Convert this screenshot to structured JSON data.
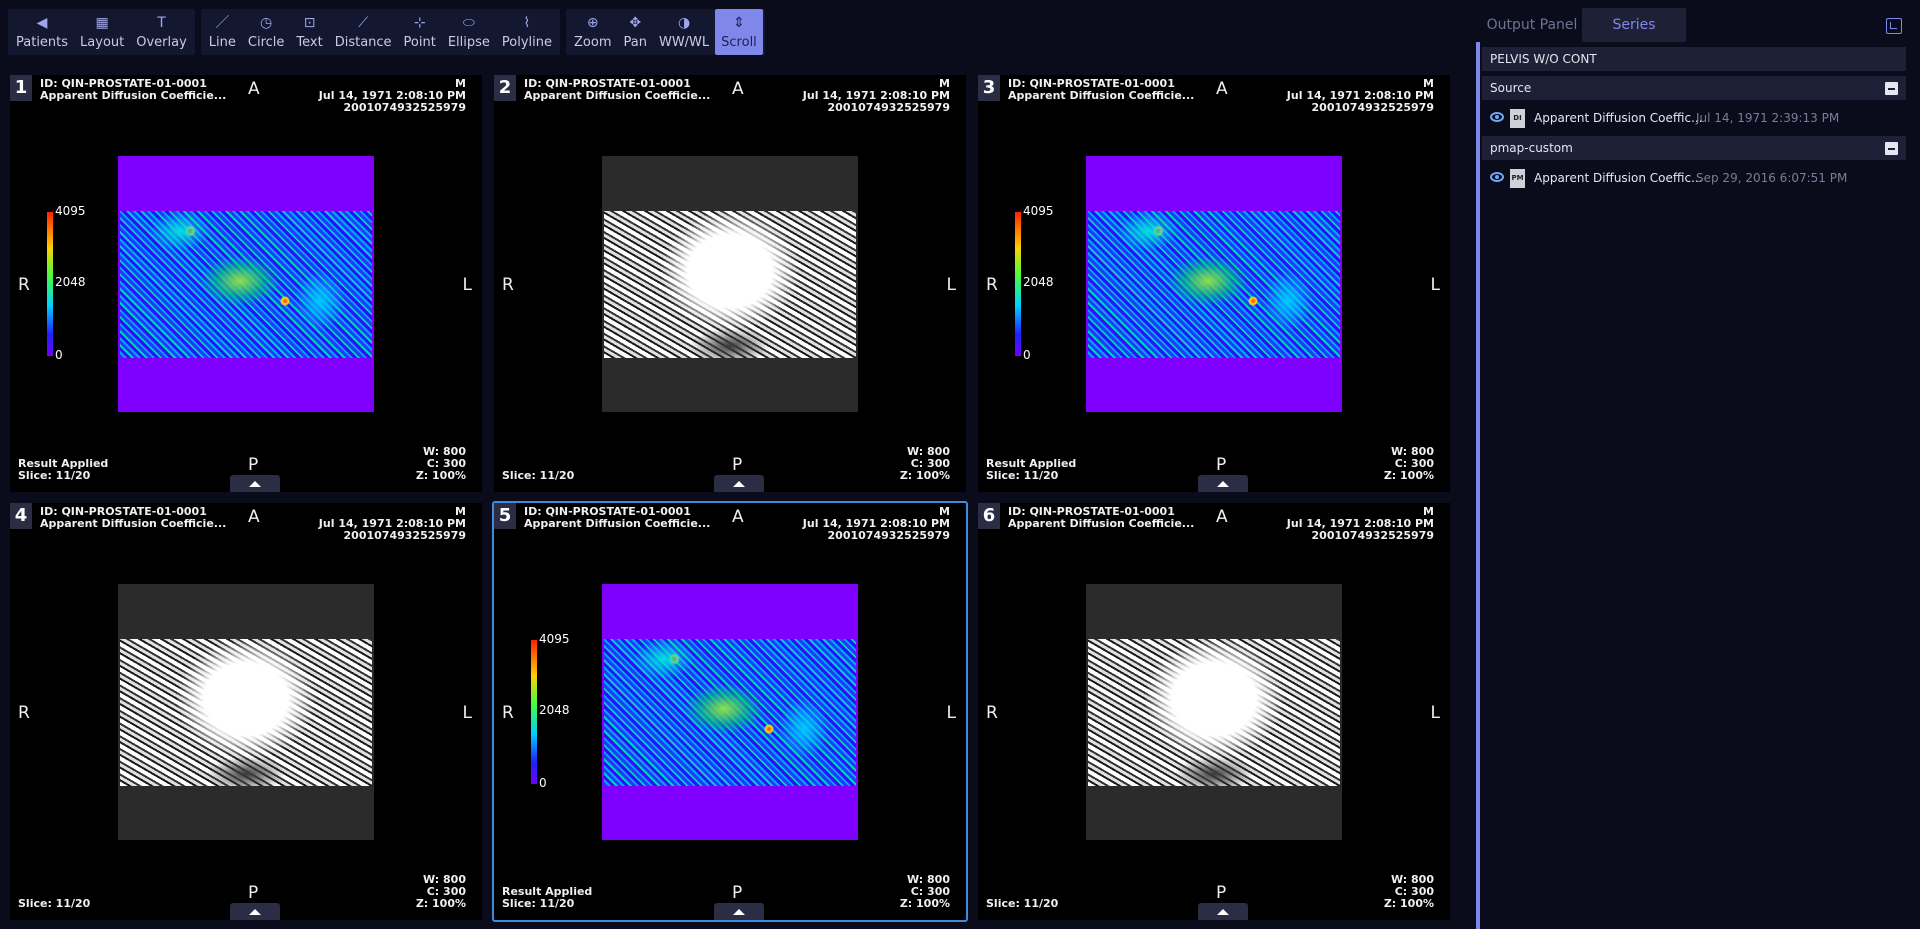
{
  "toolbar": {
    "groups": [
      [
        {
          "name": "patients",
          "label": "Patients",
          "icon": "◀"
        },
        {
          "name": "layout",
          "label": "Layout",
          "icon": "▦"
        },
        {
          "name": "overlay",
          "label": "Overlay",
          "icon": "T"
        }
      ],
      [
        {
          "name": "line",
          "label": "Line",
          "icon": "／"
        },
        {
          "name": "circle",
          "label": "Circle",
          "icon": "◷"
        },
        {
          "name": "text",
          "label": "Text",
          "icon": "⊡"
        },
        {
          "name": "distance",
          "label": "Distance",
          "icon": "⟋"
        },
        {
          "name": "point",
          "label": "Point",
          "icon": "⊹"
        },
        {
          "name": "ellipse",
          "label": "Ellipse",
          "icon": "⬭"
        },
        {
          "name": "polyline",
          "label": "Polyline",
          "icon": "⌇"
        }
      ],
      [
        {
          "name": "zoom",
          "label": "Zoom",
          "icon": "⊕"
        },
        {
          "name": "pan",
          "label": "Pan",
          "icon": "✥"
        },
        {
          "name": "wwwl",
          "label": "WW/WL",
          "icon": "◑"
        },
        {
          "name": "scroll",
          "label": "Scroll",
          "icon": "⇕",
          "active": true
        }
      ]
    ]
  },
  "viewports": [
    {
      "num": "1",
      "id": "ID: QIN-PROSTATE-01-0001",
      "desc": "Apparent Diffusion Coefficie...",
      "sex": "M",
      "date": "Jul 14, 1971 2:08:10 PM",
      "uid": "2001074932525979",
      "result": "Result Applied",
      "slice": "Slice: 11/20",
      "w": "W: 800",
      "c": "C: 300",
      "z": "Z: 100%",
      "color": true,
      "active": false
    },
    {
      "num": "2",
      "id": "ID: QIN-PROSTATE-01-0001",
      "desc": "Apparent Diffusion Coefficie...",
      "sex": "M",
      "date": "Jul 14, 1971 2:08:10 PM",
      "uid": "2001074932525979",
      "result": "",
      "slice": "Slice: 11/20",
      "w": "W: 800",
      "c": "C: 300",
      "z": "Z: 100%",
      "color": false,
      "active": false
    },
    {
      "num": "3",
      "id": "ID: QIN-PROSTATE-01-0001",
      "desc": "Apparent Diffusion Coefficie...",
      "sex": "M",
      "date": "Jul 14, 1971 2:08:10 PM",
      "uid": "2001074932525979",
      "result": "Result Applied",
      "slice": "Slice: 11/20",
      "w": "W: 800",
      "c": "C: 300",
      "z": "Z: 100%",
      "color": true,
      "active": false
    },
    {
      "num": "4",
      "id": "ID: QIN-PROSTATE-01-0001",
      "desc": "Apparent Diffusion Coefficie...",
      "sex": "M",
      "date": "Jul 14, 1971 2:08:10 PM",
      "uid": "2001074932525979",
      "result": "",
      "slice": "Slice: 11/20",
      "w": "W: 800",
      "c": "C: 300",
      "z": "Z: 100%",
      "color": false,
      "active": false
    },
    {
      "num": "5",
      "id": "ID: QIN-PROSTATE-01-0001",
      "desc": "Apparent Diffusion Coefficie...",
      "sex": "M",
      "date": "Jul 14, 1971 2:08:10 PM",
      "uid": "2001074932525979",
      "result": "Result Applied",
      "slice": "Slice: 11/20",
      "w": "W: 800",
      "c": "C: 300",
      "z": "Z: 100%",
      "color": true,
      "active": true
    },
    {
      "num": "6",
      "id": "ID: QIN-PROSTATE-01-0001",
      "desc": "Apparent Diffusion Coefficie...",
      "sex": "M",
      "date": "Jul 14, 1971 2:08:10 PM",
      "uid": "2001074932525979",
      "result": "",
      "slice": "Slice: 11/20",
      "w": "W: 800",
      "c": "C: 300",
      "z": "Z: 100%",
      "color": false,
      "active": false
    }
  ],
  "orientation": {
    "a": "A",
    "p": "P",
    "r": "R",
    "l": "L"
  },
  "colorbar": {
    "max": "4095",
    "mid": "2048",
    "min": "0"
  },
  "panel": {
    "tabs": {
      "output": "Output Panel",
      "series": "Series"
    },
    "study_title": "PELVIS W/O CONT",
    "sections": [
      {
        "title": "Source",
        "items": [
          {
            "icon": "DI",
            "name": "Apparent Diffusion Coeffic...",
            "date": "Jul 14, 1971 2:39:13 PM"
          }
        ]
      },
      {
        "title": "pmap-custom",
        "items": [
          {
            "icon": "PM",
            "name": "Apparent Diffusion Coeffic...",
            "date": "Sep 29, 2016 6:07:51 PM"
          }
        ]
      }
    ]
  }
}
